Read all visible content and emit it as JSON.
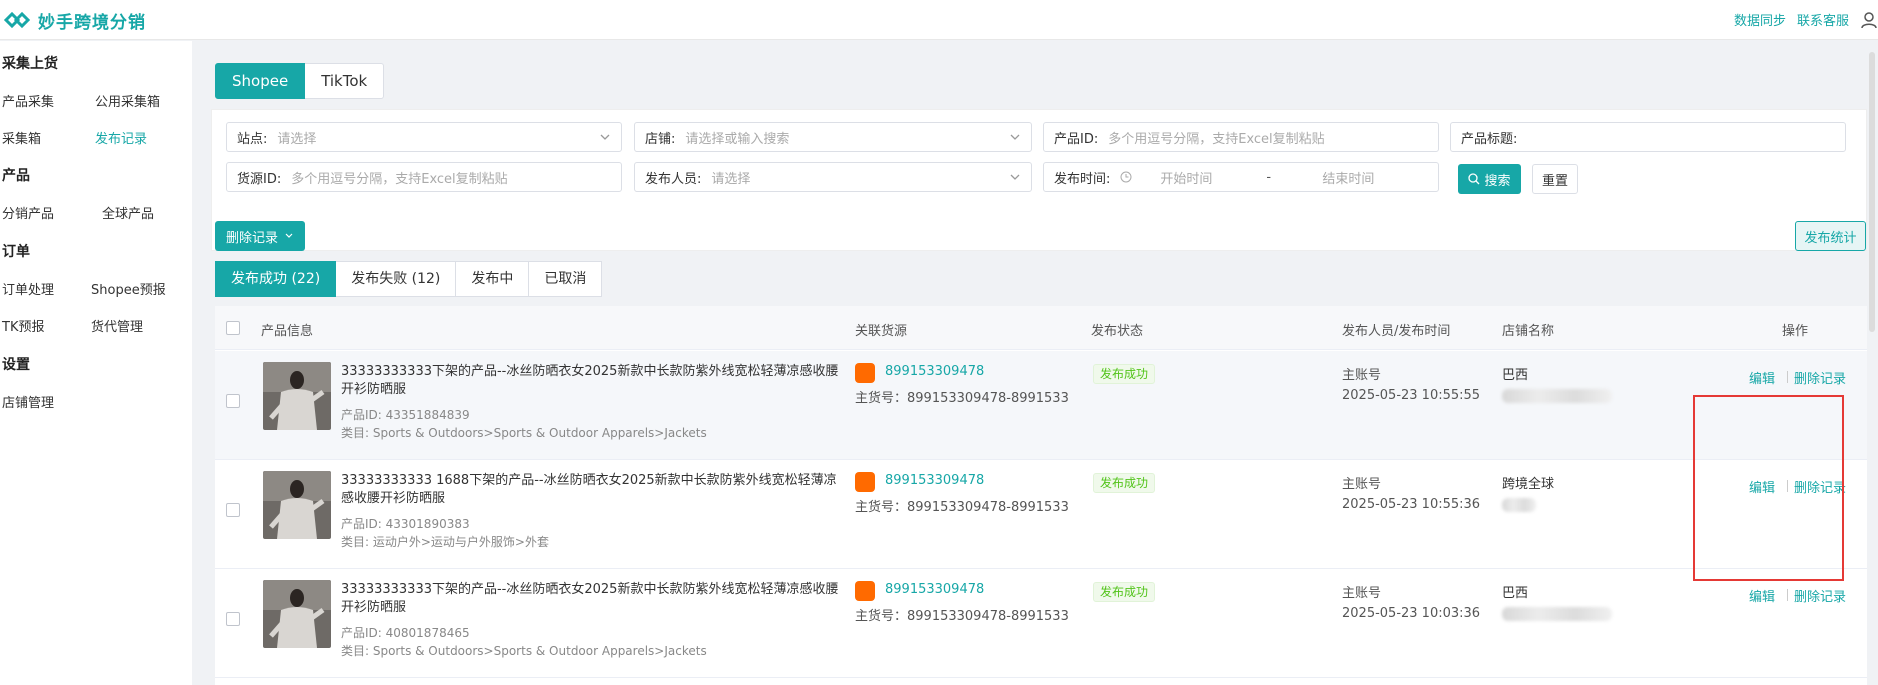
{
  "app": {
    "title": "妙手跨境分销",
    "brand_color": "#17a7a7"
  },
  "header": {
    "links": [
      "数据同步",
      "联系客服"
    ],
    "user_icon": "user-icon"
  },
  "sidebar": {
    "groups": [
      {
        "title": "采集上货",
        "items": [
          "产品采集",
          "公用采集箱",
          "采集箱",
          "发布记录"
        ]
      },
      {
        "title": "产品",
        "items": [
          "分销产品",
          "全球产品"
        ]
      },
      {
        "title": "订单",
        "items": [
          "订单处理",
          "Shopee预报",
          "TK预报",
          "货代管理"
        ]
      },
      {
        "title": "设置",
        "items": [
          "店铺管理"
        ]
      }
    ],
    "active": "发布记录"
  },
  "platform_tabs": [
    "Shopee",
    "TikTok"
  ],
  "filters": {
    "site": {
      "label": "站点:",
      "placeholder": "请选择"
    },
    "shop": {
      "label": "店铺:",
      "placeholder": "请选择或输入搜索"
    },
    "product_id": {
      "label": "产品ID:",
      "placeholder": "多个用逗号分隔，支持Excel复制粘贴"
    },
    "product_title": {
      "label": "产品标题:",
      "placeholder": ""
    },
    "source_id": {
      "label": "货源ID:",
      "placeholder": "多个用逗号分隔，支持Excel复制粘贴"
    },
    "publisher": {
      "label": "发布人员:",
      "placeholder": "请选择"
    },
    "publish_time": {
      "label": "发布时间:",
      "start": "开始时间",
      "sep": "-",
      "end": "结束时间"
    },
    "search_btn": "搜索",
    "reset_btn": "重置"
  },
  "actions": {
    "delete_records": "删除记录",
    "publish_stats": "发布统计"
  },
  "status_tabs": [
    "发布成功 (22)",
    "发布失败 (12)",
    "发布中",
    "已取消"
  ],
  "table": {
    "columns": [
      "产品信息",
      "关联货源",
      "发布状态",
      "发布人员/发布时间",
      "店铺名称",
      "操作"
    ],
    "rows": [
      {
        "title": "33333333333下架的产品--冰丝防晒衣女2025新款中长款防紫外线宽松轻薄凉感收腰开衫防晒服",
        "product_id": "产品ID: 43351884839",
        "category": "类目: Sports & Outdoors>Sports & Outdoor Apparels>Jackets",
        "source_link": "899153309478",
        "source_main": "主货号：899153309478-8991533",
        "status": "发布成功",
        "publisher": "主账号",
        "time": "2025-05-23 10:55:55",
        "shop": "巴西",
        "ops": [
          "编辑",
          "删除记录"
        ]
      },
      {
        "title": "33333333333 1688下架的产品--冰丝防晒衣女2025新款中长款防紫外线宽松轻薄凉感收腰开衫防晒服",
        "product_id": "产品ID: 43301890383",
        "category": "类目: 运动户外>运动与户外服饰>外套",
        "source_link": "899153309478",
        "source_main": "主货号：899153309478-8991533",
        "status": "发布成功",
        "publisher": "主账号",
        "time": "2025-05-23 10:55:36",
        "shop": "跨境全球",
        "ops": [
          "编辑",
          "删除记录"
        ]
      },
      {
        "title": "33333333333下架的产品--冰丝防晒衣女2025新款中长款防紫外线宽松轻薄凉感收腰开衫防晒服",
        "product_id": "产品ID: 40801878465",
        "category": "类目: Sports & Outdoors>Sports & Outdoor Apparels>Jackets",
        "source_link": "899153309478",
        "source_main": "主货号：899153309478-8991533",
        "status": "发布成功",
        "publisher": "主账号",
        "time": "2025-05-23 10:03:36",
        "shop": "巴西",
        "ops": [
          "编辑",
          "删除记录"
        ]
      }
    ]
  }
}
